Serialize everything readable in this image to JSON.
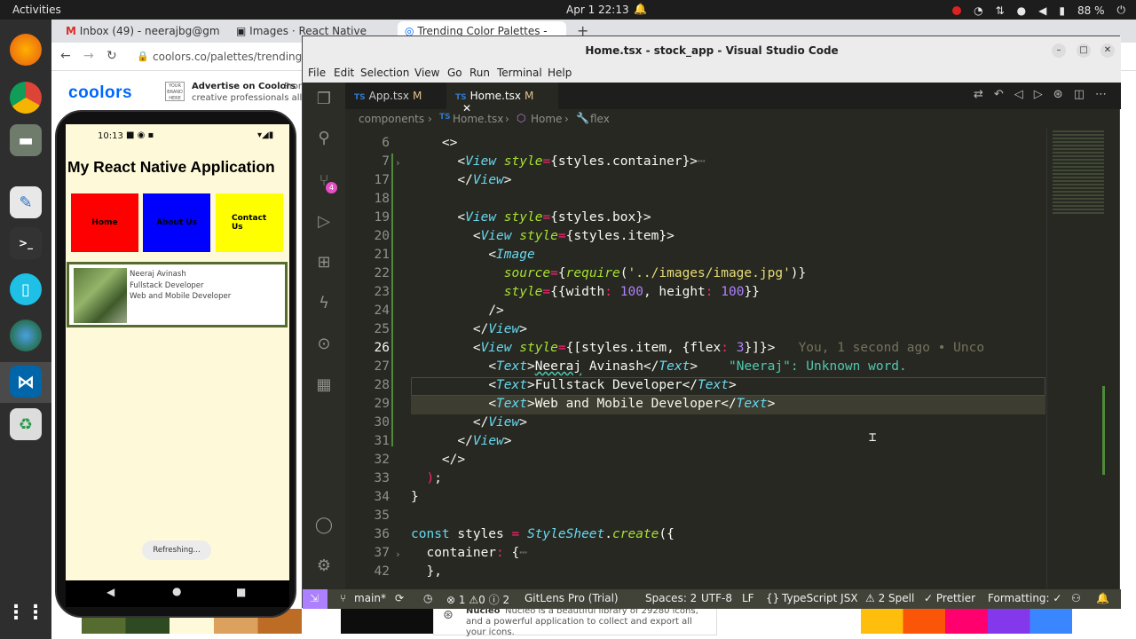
{
  "topbar": {
    "activities": "Activities",
    "clock": "Apr 1  22:13",
    "battery": "88 %"
  },
  "browser": {
    "tabs": [
      {
        "label": "Inbox (49) - neerajbg@gm",
        "icon": "gmail-icon"
      },
      {
        "label": "Images · React Native",
        "icon": "docs-icon"
      },
      {
        "label": "Trending Color Palettes -",
        "icon": "coolors-icon"
      }
    ],
    "url": "coolors.co/palettes/trending",
    "logo": "coolors",
    "ad_box": "YOUR BRAND HERE",
    "ad_title": "Advertise on Coolors",
    "ad_sub": "creative professionals all ov",
    "ad_promo": "Prom"
  },
  "phone": {
    "time": "10:13",
    "title": "My React Native Application",
    "buttons": [
      {
        "label": "Home",
        "color": "#ff0000"
      },
      {
        "label": "About Us",
        "color": "#0000ff"
      },
      {
        "label": "Contact Us",
        "color": "#ffff00"
      }
    ],
    "card_lines": [
      "Neeraj Avinash",
      "Fullstack Developer",
      "Web and Mobile Developer"
    ],
    "refresh": "Refreshing..."
  },
  "vscode": {
    "title": "Home.tsx - stock_app - Visual Studio Code",
    "menu": [
      "File",
      "Edit",
      "Selection",
      "View",
      "Go",
      "Run",
      "Terminal",
      "Help"
    ],
    "tabs": [
      {
        "label": "App.tsx",
        "mod": "M",
        "active": false
      },
      {
        "label": "Home.tsx",
        "mod": "M",
        "active": true
      }
    ],
    "breadcrumb": [
      "components",
      "Home.tsx",
      "Home",
      "flex"
    ],
    "scm_badge": "4",
    "line_numbers": [
      "6",
      "7",
      "17",
      "18",
      "19",
      "20",
      "21",
      "22",
      "23",
      "24",
      "25",
      "26",
      "27",
      "28",
      "29",
      "30",
      "31",
      "32",
      "33",
      "34",
      "35",
      "36",
      "37",
      "42"
    ],
    "blame": "You, 1 second ago • Unco",
    "diagnostic": "\"Neeraj\": Unknown word.",
    "status": {
      "branch": "main*",
      "errors": "1",
      "warnings": "0",
      "info": "2",
      "gitlens": "GitLens Pro (Trial)",
      "spaces": "Spaces: 2",
      "encoding": "UTF-8",
      "eol": "LF",
      "language": "TypeScript JSX",
      "spell": "2 Spell",
      "prettier": "Prettier",
      "formatting": "Formatting: ✓"
    }
  },
  "nucleo": {
    "title": "Nucleo",
    "text": "Nucleo is a beautiful library of 29280 icons, and a powerful application to collect and export all your icons."
  }
}
